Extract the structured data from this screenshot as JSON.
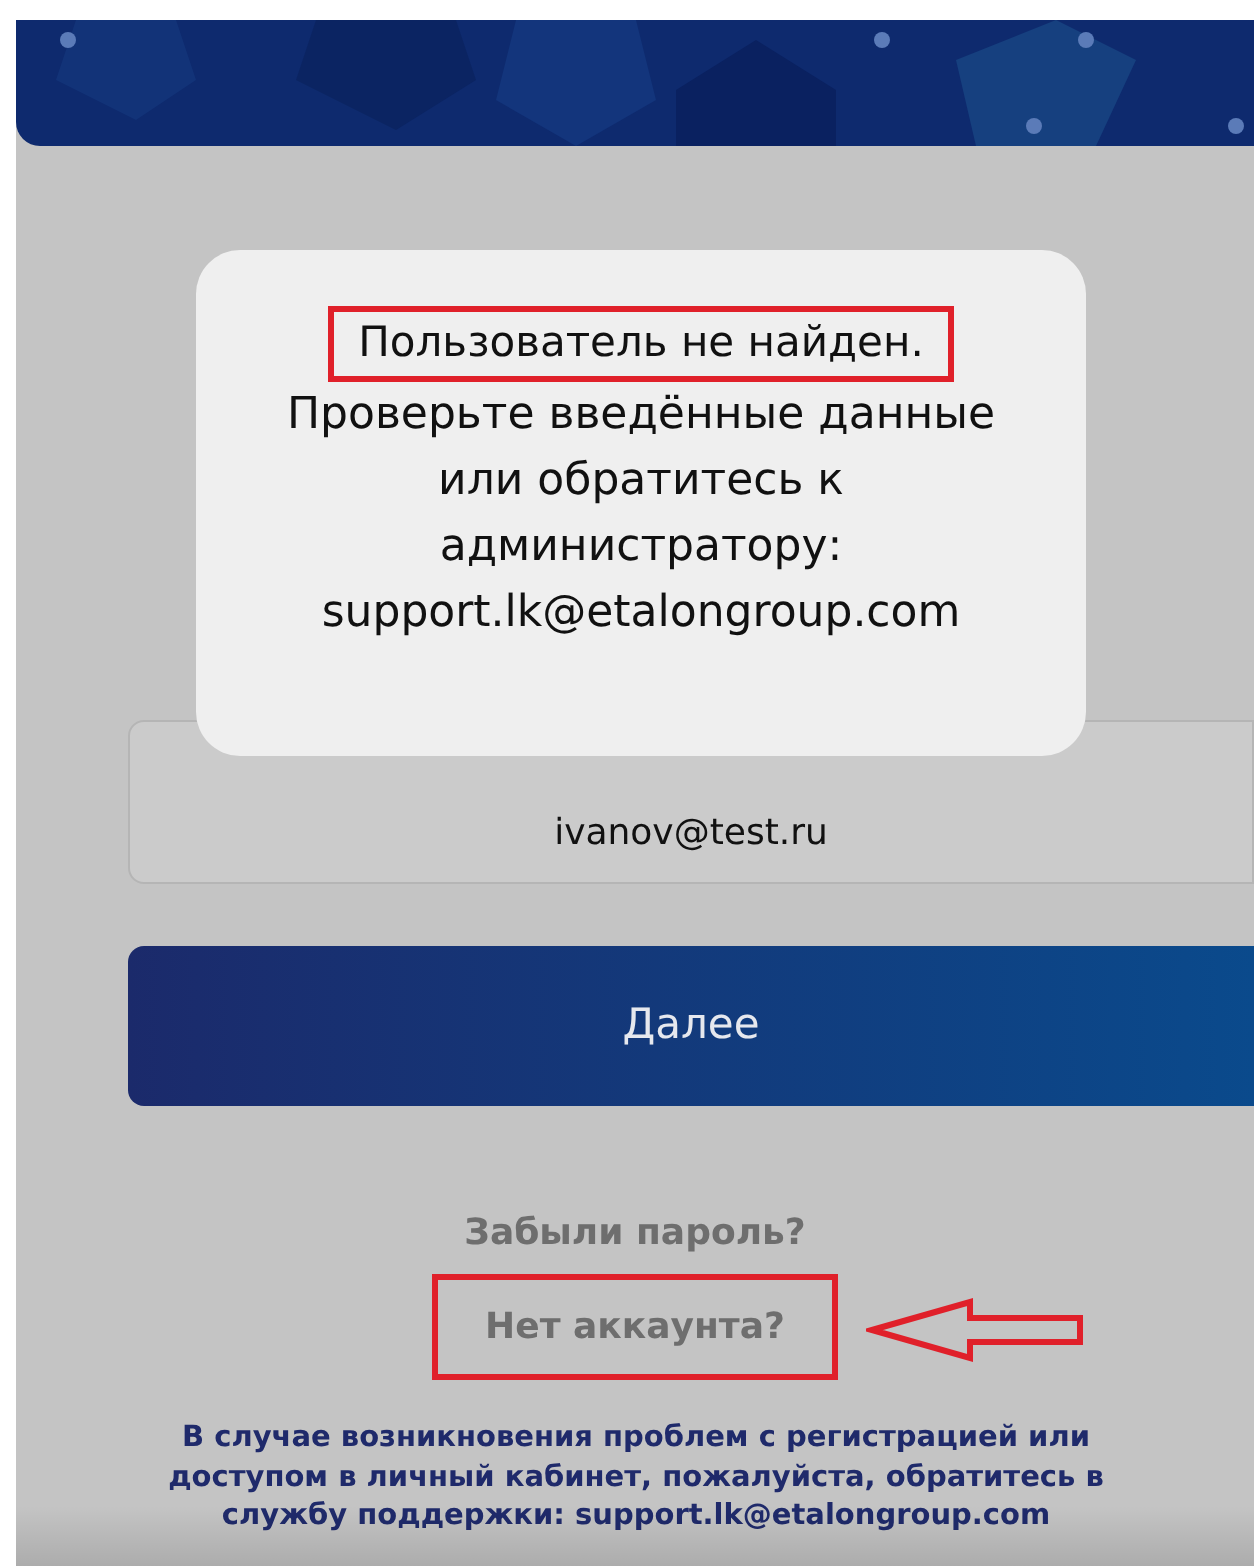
{
  "alert": {
    "title": "Пользователь не найден.",
    "title_highlighted": true,
    "message": "Проверьте введённые данные или обратитесь к администратору: support.lk@etalongroup.com"
  },
  "login_field": {
    "value": "ivanov@test.ru"
  },
  "next_button": {
    "label": "Далее"
  },
  "links": [
    {
      "label": "Забыли пароль?",
      "highlighted": false,
      "arrow": false
    },
    {
      "label": "Нет аккаунта?",
      "highlighted": true,
      "arrow": true
    }
  ],
  "footer_note": "В случае возникновения проблем с регистрацией или доступом в личный кабинет, пожалуйста, обратитесь в службу поддержки: support.lk@etalongroup.com"
}
